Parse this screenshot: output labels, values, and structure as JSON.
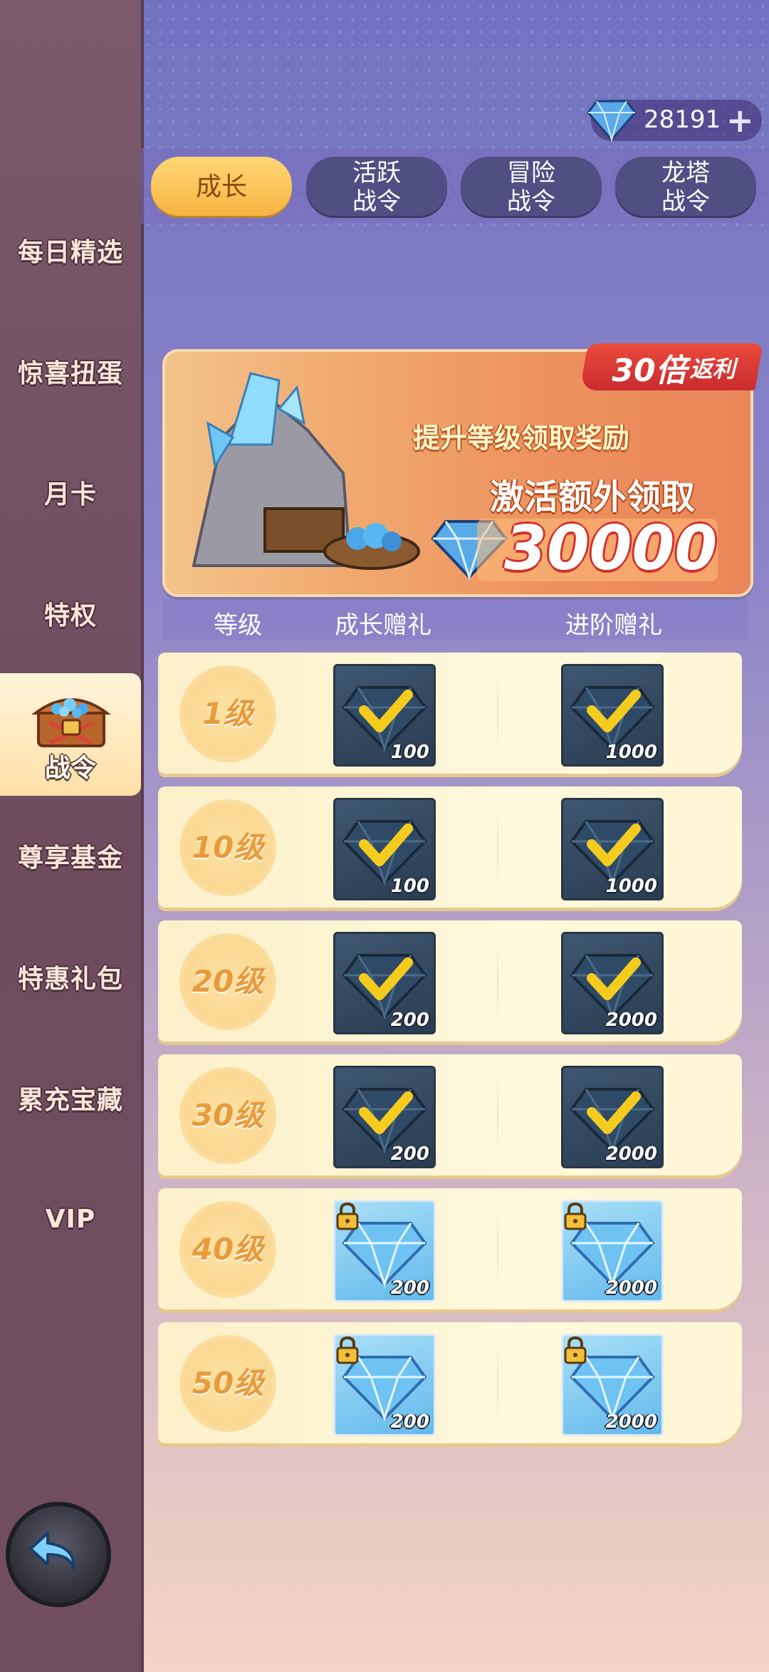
{
  "currency": {
    "diamonds": "28191",
    "add_label": "+"
  },
  "tabs": [
    {
      "label": "成长",
      "active": true
    },
    {
      "label": "活跃\n战令",
      "active": false
    },
    {
      "label": "冒险\n战令",
      "active": false
    },
    {
      "label": "龙塔\n战令",
      "active": false
    }
  ],
  "sidebar": {
    "items": [
      {
        "label": "每日精选"
      },
      {
        "label": "惊喜扭蛋"
      },
      {
        "label": "月卡"
      },
      {
        "label": "特权"
      },
      {
        "label": "战令",
        "active": true
      },
      {
        "label": "尊享基金"
      },
      {
        "label": "特惠礼包"
      },
      {
        "label": "累充宝藏"
      },
      {
        "label": "VIP"
      }
    ]
  },
  "banner": {
    "tag": "30倍",
    "tag_suffix": "返利",
    "line1": "提升等级领取奖励",
    "line2": "激活额外领取",
    "amount": "30000"
  },
  "columns": {
    "level": "等级",
    "growth": "成长赠礼",
    "advanced": "进阶赠礼"
  },
  "rows": [
    {
      "level": "1级",
      "growth": "100",
      "advanced": "1000",
      "status": "claimed"
    },
    {
      "level": "10级",
      "growth": "100",
      "advanced": "1000",
      "status": "claimed"
    },
    {
      "level": "20级",
      "growth": "200",
      "advanced": "2000",
      "status": "claimed"
    },
    {
      "level": "30级",
      "growth": "200",
      "advanced": "2000",
      "status": "claimed"
    },
    {
      "level": "40级",
      "growth": "200",
      "advanced": "2000",
      "status": "locked"
    },
    {
      "level": "50级",
      "growth": "200",
      "advanced": "2000",
      "status": "locked"
    }
  ],
  "colors": {
    "accent_gold": "#f7b23f",
    "level_text": "#e89b3d",
    "tag_red": "#d1302e"
  }
}
